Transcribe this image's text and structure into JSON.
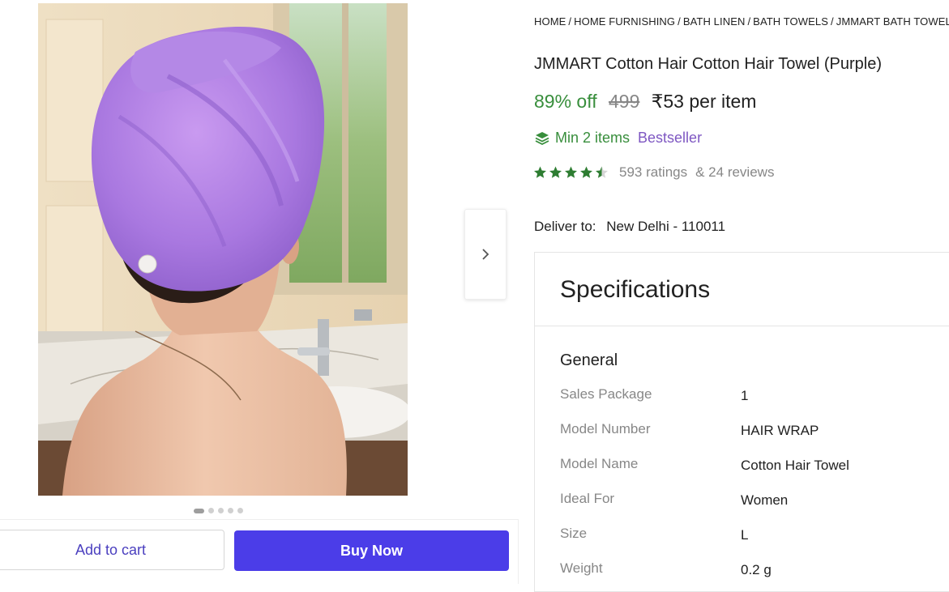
{
  "breadcrumb": {
    "items": [
      "HOME",
      "HOME FURNISHING",
      "BATH LINEN",
      "BATH TOWELS",
      "JMMART BATH TOWELS"
    ],
    "separator": "/"
  },
  "product": {
    "title": "JMMART Cotton Hair Cotton Hair Towel (Purple)",
    "discount": "89% off",
    "mrp": "499",
    "price": "₹53 per item",
    "min_items": "Min 2 items",
    "badge": "Bestseller",
    "rating_value": 4.5,
    "ratings_count": "593 ratings",
    "reviews_count": "& 24 reviews",
    "image_icon": "purple-hair-towel-photo"
  },
  "carousel": {
    "dots": 5,
    "active_index": 0
  },
  "delivery": {
    "label": "Deliver to:",
    "location": "New Delhi - 110011"
  },
  "actions": {
    "add_to_cart": "Add to cart",
    "buy_now": "Buy Now"
  },
  "specifications": {
    "heading": "Specifications",
    "group_title": "General",
    "rows": [
      {
        "key": "Sales Package",
        "value": "1"
      },
      {
        "key": "Model Number",
        "value": "HAIR WRAP"
      },
      {
        "key": "Model Name",
        "value": "Cotton Hair Towel"
      },
      {
        "key": "Ideal For",
        "value": "Women"
      },
      {
        "key": "Size",
        "value": "L"
      },
      {
        "key": "Weight",
        "value": "0.2 g"
      }
    ]
  },
  "colors": {
    "discount_green": "#388e3c",
    "bestseller_purple": "#7e57c2",
    "buy_button": "#4b3de8",
    "cart_text": "#4a3fbf",
    "star_green": "#388e3c",
    "muted_gray": "#878787"
  }
}
